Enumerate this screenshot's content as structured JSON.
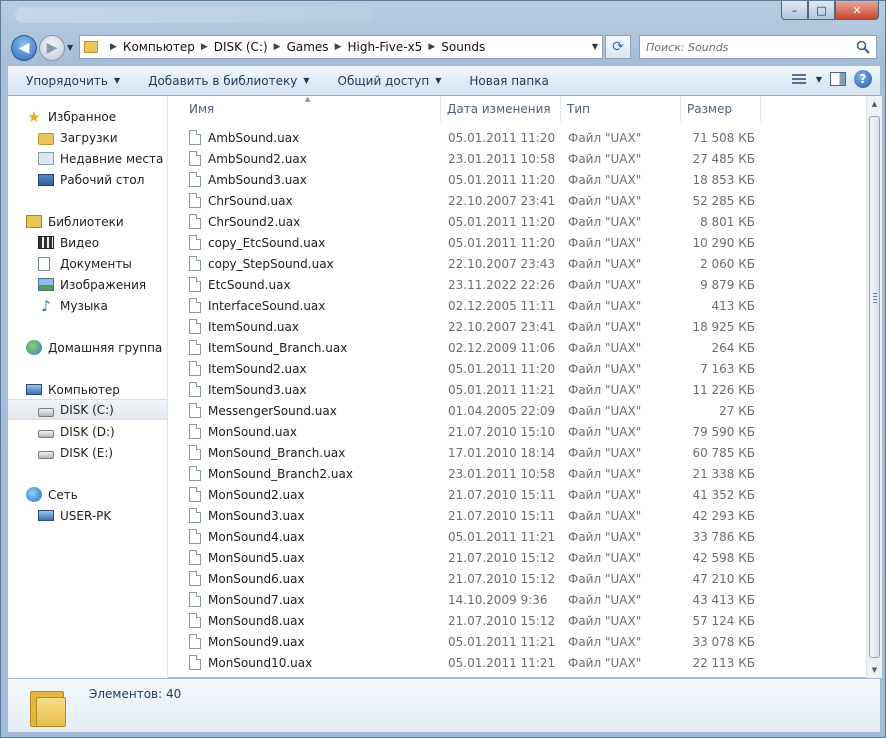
{
  "window": {
    "caption_buttons": {
      "minimize": "–",
      "maximize": "□",
      "close": "✕"
    }
  },
  "address": {
    "crumbs": [
      "Компьютер",
      "DISK (C:)",
      "Games",
      "High-Five-x5",
      "Sounds"
    ],
    "search_placeholder": "Поиск: Sounds"
  },
  "toolbar": {
    "organize": "Упорядочить",
    "add_to_library": "Добавить в библиотеку",
    "share": "Общий доступ",
    "new_folder": "Новая папка"
  },
  "sidebar": {
    "favorites": {
      "label": "Избранное",
      "items": [
        "Загрузки",
        "Недавние места",
        "Рабочий стол"
      ]
    },
    "libraries": {
      "label": "Библиотеки",
      "items": [
        "Видео",
        "Документы",
        "Изображения",
        "Музыка"
      ]
    },
    "homegroup": {
      "label": "Домашняя группа"
    },
    "computer": {
      "label": "Компьютер",
      "items": [
        "DISK (C:)",
        "DISK (D:)",
        "DISK (E:)"
      ],
      "selected": "DISK (C:)"
    },
    "network": {
      "label": "Сеть",
      "items": [
        "USER-PK"
      ]
    }
  },
  "columns": {
    "name": "Имя",
    "date": "Дата изменения",
    "type": "Тип",
    "size": "Размер"
  },
  "files": [
    {
      "name": "AmbSound.uax",
      "date": "05.01.2011 11:20",
      "type": "Файл \"UAX\"",
      "size": "71 508 КБ"
    },
    {
      "name": "AmbSound2.uax",
      "date": "23.01.2011 10:58",
      "type": "Файл \"UAX\"",
      "size": "27 485 КБ"
    },
    {
      "name": "AmbSound3.uax",
      "date": "05.01.2011 11:20",
      "type": "Файл \"UAX\"",
      "size": "18 853 КБ"
    },
    {
      "name": "ChrSound.uax",
      "date": "22.10.2007 23:41",
      "type": "Файл \"UAX\"",
      "size": "52 285 КБ"
    },
    {
      "name": "ChrSound2.uax",
      "date": "05.01.2011 11:20",
      "type": "Файл \"UAX\"",
      "size": "8 801 КБ"
    },
    {
      "name": "copy_EtcSound.uax",
      "date": "05.01.2011 11:20",
      "type": "Файл \"UAX\"",
      "size": "10 290 КБ"
    },
    {
      "name": "copy_StepSound.uax",
      "date": "22.10.2007 23:43",
      "type": "Файл \"UAX\"",
      "size": "2 060 КБ"
    },
    {
      "name": "EtcSound.uax",
      "date": "23.11.2022 22:26",
      "type": "Файл \"UAX\"",
      "size": "9 879 КБ"
    },
    {
      "name": "InterfaceSound.uax",
      "date": "02.12.2005 11:11",
      "type": "Файл \"UAX\"",
      "size": "413 КБ"
    },
    {
      "name": "ItemSound.uax",
      "date": "22.10.2007 23:41",
      "type": "Файл \"UAX\"",
      "size": "18 925 КБ"
    },
    {
      "name": "ItemSound_Branch.uax",
      "date": "02.12.2009 11:06",
      "type": "Файл \"UAX\"",
      "size": "264 КБ"
    },
    {
      "name": "ItemSound2.uax",
      "date": "05.01.2011 11:20",
      "type": "Файл \"UAX\"",
      "size": "7 163 КБ"
    },
    {
      "name": "ItemSound3.uax",
      "date": "05.01.2011 11:21",
      "type": "Файл \"UAX\"",
      "size": "11 226 КБ"
    },
    {
      "name": "MessengerSound.uax",
      "date": "01.04.2005 22:09",
      "type": "Файл \"UAX\"",
      "size": "27 КБ"
    },
    {
      "name": "MonSound.uax",
      "date": "21.07.2010 15:10",
      "type": "Файл \"UAX\"",
      "size": "79 590 КБ"
    },
    {
      "name": "MonSound_Branch.uax",
      "date": "17.01.2010 18:14",
      "type": "Файл \"UAX\"",
      "size": "60 785 КБ"
    },
    {
      "name": "MonSound_Branch2.uax",
      "date": "23.01.2011 10:58",
      "type": "Файл \"UAX\"",
      "size": "21 338 КБ"
    },
    {
      "name": "MonSound2.uax",
      "date": "21.07.2010 15:11",
      "type": "Файл \"UAX\"",
      "size": "41 352 КБ"
    },
    {
      "name": "MonSound3.uax",
      "date": "21.07.2010 15:11",
      "type": "Файл \"UAX\"",
      "size": "42 293 КБ"
    },
    {
      "name": "MonSound4.uax",
      "date": "05.01.2011 11:21",
      "type": "Файл \"UAX\"",
      "size": "33 786 КБ"
    },
    {
      "name": "MonSound5.uax",
      "date": "21.07.2010 15:12",
      "type": "Файл \"UAX\"",
      "size": "42 598 КБ"
    },
    {
      "name": "MonSound6.uax",
      "date": "21.07.2010 15:12",
      "type": "Файл \"UAX\"",
      "size": "47 210 КБ"
    },
    {
      "name": "MonSound7.uax",
      "date": "14.10.2009 9:36",
      "type": "Файл \"UAX\"",
      "size": "43 413 КБ"
    },
    {
      "name": "MonSound8.uax",
      "date": "21.07.2010 15:12",
      "type": "Файл \"UAX\"",
      "size": "57 124 КБ"
    },
    {
      "name": "MonSound9.uax",
      "date": "05.01.2011 11:21",
      "type": "Файл \"UAX\"",
      "size": "33 078 КБ"
    },
    {
      "name": "MonSound10.uax",
      "date": "05.01.2011 11:21",
      "type": "Файл \"UAX\"",
      "size": "22 113 КБ"
    }
  ],
  "status": {
    "items_count": "Элементов: 40"
  },
  "icons": {
    "favorites": "star-icon",
    "downloads": "folder-icon",
    "recent": "recent-places-icon",
    "desktop": "desktop-icon",
    "libraries": "library-icon",
    "video": "video-icon",
    "documents": "document-icon",
    "images": "image-icon",
    "music": "music-icon",
    "homegroup": "homegroup-icon",
    "computer": "computer-icon",
    "drive": "drive-icon",
    "network": "network-icon",
    "file": "file-icon"
  }
}
